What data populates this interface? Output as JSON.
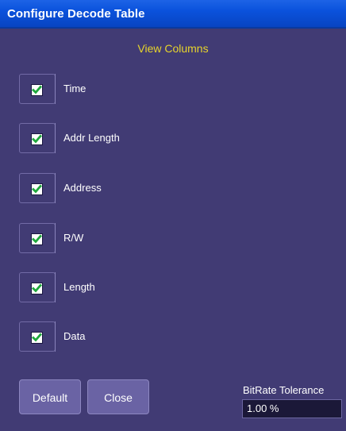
{
  "window": {
    "title": "Configure  Decode Table"
  },
  "section": {
    "title": "View Columns"
  },
  "columns": [
    {
      "label": "Time",
      "checked": true
    },
    {
      "label": "Addr Length",
      "checked": true
    },
    {
      "label": "Address",
      "checked": true
    },
    {
      "label": "R/W",
      "checked": true
    },
    {
      "label": "Length",
      "checked": true
    },
    {
      "label": "Data",
      "checked": true
    }
  ],
  "buttons": {
    "default_label": "Default",
    "close_label": "Close"
  },
  "bitrate_tolerance": {
    "label": "BitRate Tolerance",
    "value": "1.00 %"
  },
  "colors": {
    "check": "#1fa83c",
    "accent_text": "#e7d42b",
    "background": "#413b74",
    "title_bar": "#0a52dc"
  }
}
